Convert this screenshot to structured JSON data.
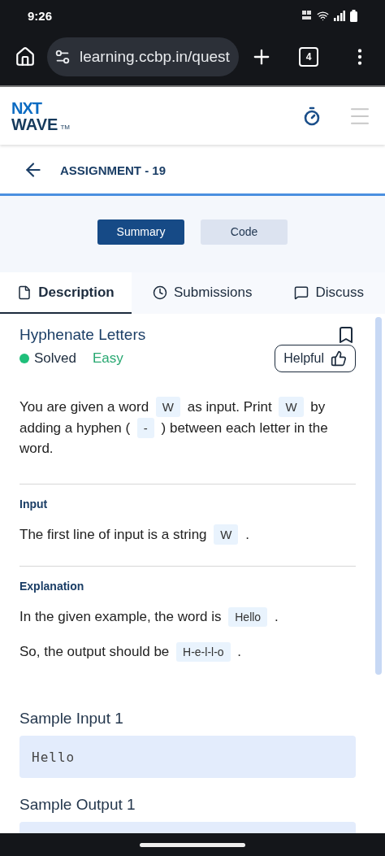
{
  "status_bar": {
    "time": "9:26"
  },
  "browser": {
    "url": "learning.ccbp.in/quest",
    "tab_count": "4"
  },
  "header": {
    "logo_top": "NXT",
    "logo_bottom": "WAVE",
    "logo_mark": "TM"
  },
  "assignment": {
    "title": "ASSIGNMENT - 19"
  },
  "view_toggle": [
    {
      "label": "Summary",
      "selected": true
    },
    {
      "label": "Code",
      "selected": false
    }
  ],
  "tabs": [
    {
      "label": "Description",
      "selected": true
    },
    {
      "label": "Submissions",
      "selected": false
    },
    {
      "label": "Discuss",
      "selected": false
    }
  ],
  "problem": {
    "title": "Hyphenate Letters",
    "status": {
      "label": "Solved",
      "color": "#1fbf7a"
    },
    "difficulty": "Easy",
    "helpful_button": "Helpful",
    "sections": [
      {
        "kind": "paragraph",
        "parts": [
          {
            "kind": "text",
            "text": "You are given a word "
          },
          {
            "kind": "code",
            "text": "W"
          },
          {
            "kind": "text",
            "text": " as input. Print "
          },
          {
            "kind": "code",
            "text": "W"
          },
          {
            "kind": "text",
            "text": " by adding a hyphen ( "
          },
          {
            "kind": "code",
            "text": "-"
          },
          {
            "kind": "text",
            "text": " ) between each letter in the word."
          }
        ]
      },
      {
        "kind": "divider"
      },
      {
        "kind": "heading",
        "text": "Input"
      },
      {
        "kind": "paragraph",
        "parts": [
          {
            "kind": "text",
            "text": "The first line of input is a string "
          },
          {
            "kind": "code",
            "text": "W"
          },
          {
            "kind": "text",
            "text": " ."
          }
        ]
      },
      {
        "kind": "divider"
      },
      {
        "kind": "heading",
        "text": "Explanation"
      },
      {
        "kind": "paragraph",
        "parts": [
          {
            "kind": "text",
            "text": "In the given example, the word is "
          },
          {
            "kind": "code",
            "text": "Hello"
          },
          {
            "kind": "text",
            "text": " ."
          }
        ]
      },
      {
        "kind": "paragraph",
        "parts": [
          {
            "kind": "text",
            "text": "So, the output should be "
          },
          {
            "kind": "code",
            "text": "H-e-l-l-o"
          },
          {
            "kind": "text",
            "text": " ."
          }
        ]
      },
      {
        "kind": "sample",
        "title": "Sample Input 1",
        "code": "Hello"
      },
      {
        "kind": "sample",
        "title": "Sample Output 1"
      }
    ]
  }
}
